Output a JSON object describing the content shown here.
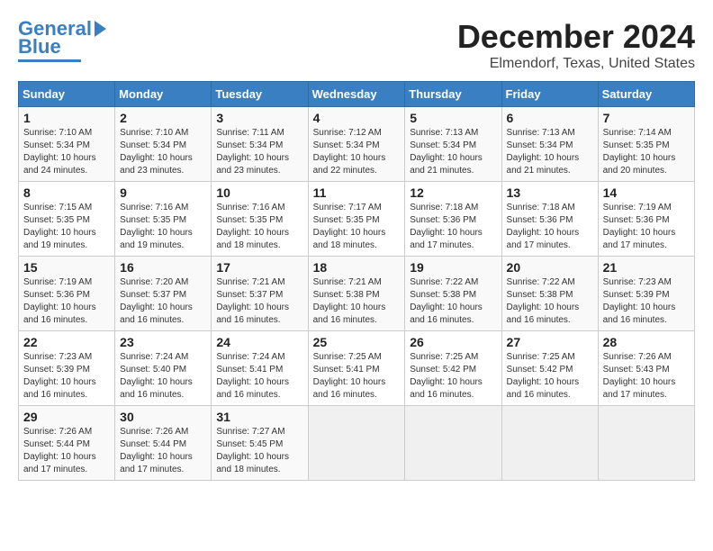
{
  "header": {
    "logo_line1": "General",
    "logo_line2": "Blue",
    "title": "December 2024",
    "subtitle": "Elmendorf, Texas, United States"
  },
  "days_of_week": [
    "Sunday",
    "Monday",
    "Tuesday",
    "Wednesday",
    "Thursday",
    "Friday",
    "Saturday"
  ],
  "weeks": [
    [
      {
        "day": "1",
        "lines": [
          "Sunrise: 7:10 AM",
          "Sunset: 5:34 PM",
          "Daylight: 10 hours",
          "and 24 minutes."
        ]
      },
      {
        "day": "2",
        "lines": [
          "Sunrise: 7:10 AM",
          "Sunset: 5:34 PM",
          "Daylight: 10 hours",
          "and 23 minutes."
        ]
      },
      {
        "day": "3",
        "lines": [
          "Sunrise: 7:11 AM",
          "Sunset: 5:34 PM",
          "Daylight: 10 hours",
          "and 23 minutes."
        ]
      },
      {
        "day": "4",
        "lines": [
          "Sunrise: 7:12 AM",
          "Sunset: 5:34 PM",
          "Daylight: 10 hours",
          "and 22 minutes."
        ]
      },
      {
        "day": "5",
        "lines": [
          "Sunrise: 7:13 AM",
          "Sunset: 5:34 PM",
          "Daylight: 10 hours",
          "and 21 minutes."
        ]
      },
      {
        "day": "6",
        "lines": [
          "Sunrise: 7:13 AM",
          "Sunset: 5:34 PM",
          "Daylight: 10 hours",
          "and 21 minutes."
        ]
      },
      {
        "day": "7",
        "lines": [
          "Sunrise: 7:14 AM",
          "Sunset: 5:35 PM",
          "Daylight: 10 hours",
          "and 20 minutes."
        ]
      }
    ],
    [
      {
        "day": "8",
        "lines": [
          "Sunrise: 7:15 AM",
          "Sunset: 5:35 PM",
          "Daylight: 10 hours",
          "and 19 minutes."
        ]
      },
      {
        "day": "9",
        "lines": [
          "Sunrise: 7:16 AM",
          "Sunset: 5:35 PM",
          "Daylight: 10 hours",
          "and 19 minutes."
        ]
      },
      {
        "day": "10",
        "lines": [
          "Sunrise: 7:16 AM",
          "Sunset: 5:35 PM",
          "Daylight: 10 hours",
          "and 18 minutes."
        ]
      },
      {
        "day": "11",
        "lines": [
          "Sunrise: 7:17 AM",
          "Sunset: 5:35 PM",
          "Daylight: 10 hours",
          "and 18 minutes."
        ]
      },
      {
        "day": "12",
        "lines": [
          "Sunrise: 7:18 AM",
          "Sunset: 5:36 PM",
          "Daylight: 10 hours",
          "and 17 minutes."
        ]
      },
      {
        "day": "13",
        "lines": [
          "Sunrise: 7:18 AM",
          "Sunset: 5:36 PM",
          "Daylight: 10 hours",
          "and 17 minutes."
        ]
      },
      {
        "day": "14",
        "lines": [
          "Sunrise: 7:19 AM",
          "Sunset: 5:36 PM",
          "Daylight: 10 hours",
          "and 17 minutes."
        ]
      }
    ],
    [
      {
        "day": "15",
        "lines": [
          "Sunrise: 7:19 AM",
          "Sunset: 5:36 PM",
          "Daylight: 10 hours",
          "and 16 minutes."
        ]
      },
      {
        "day": "16",
        "lines": [
          "Sunrise: 7:20 AM",
          "Sunset: 5:37 PM",
          "Daylight: 10 hours",
          "and 16 minutes."
        ]
      },
      {
        "day": "17",
        "lines": [
          "Sunrise: 7:21 AM",
          "Sunset: 5:37 PM",
          "Daylight: 10 hours",
          "and 16 minutes."
        ]
      },
      {
        "day": "18",
        "lines": [
          "Sunrise: 7:21 AM",
          "Sunset: 5:38 PM",
          "Daylight: 10 hours",
          "and 16 minutes."
        ]
      },
      {
        "day": "19",
        "lines": [
          "Sunrise: 7:22 AM",
          "Sunset: 5:38 PM",
          "Daylight: 10 hours",
          "and 16 minutes."
        ]
      },
      {
        "day": "20",
        "lines": [
          "Sunrise: 7:22 AM",
          "Sunset: 5:38 PM",
          "Daylight: 10 hours",
          "and 16 minutes."
        ]
      },
      {
        "day": "21",
        "lines": [
          "Sunrise: 7:23 AM",
          "Sunset: 5:39 PM",
          "Daylight: 10 hours",
          "and 16 minutes."
        ]
      }
    ],
    [
      {
        "day": "22",
        "lines": [
          "Sunrise: 7:23 AM",
          "Sunset: 5:39 PM",
          "Daylight: 10 hours",
          "and 16 minutes."
        ]
      },
      {
        "day": "23",
        "lines": [
          "Sunrise: 7:24 AM",
          "Sunset: 5:40 PM",
          "Daylight: 10 hours",
          "and 16 minutes."
        ]
      },
      {
        "day": "24",
        "lines": [
          "Sunrise: 7:24 AM",
          "Sunset: 5:41 PM",
          "Daylight: 10 hours",
          "and 16 minutes."
        ]
      },
      {
        "day": "25",
        "lines": [
          "Sunrise: 7:25 AM",
          "Sunset: 5:41 PM",
          "Daylight: 10 hours",
          "and 16 minutes."
        ]
      },
      {
        "day": "26",
        "lines": [
          "Sunrise: 7:25 AM",
          "Sunset: 5:42 PM",
          "Daylight: 10 hours",
          "and 16 minutes."
        ]
      },
      {
        "day": "27",
        "lines": [
          "Sunrise: 7:25 AM",
          "Sunset: 5:42 PM",
          "Daylight: 10 hours",
          "and 16 minutes."
        ]
      },
      {
        "day": "28",
        "lines": [
          "Sunrise: 7:26 AM",
          "Sunset: 5:43 PM",
          "Daylight: 10 hours",
          "and 17 minutes."
        ]
      }
    ],
    [
      {
        "day": "29",
        "lines": [
          "Sunrise: 7:26 AM",
          "Sunset: 5:44 PM",
          "Daylight: 10 hours",
          "and 17 minutes."
        ]
      },
      {
        "day": "30",
        "lines": [
          "Sunrise: 7:26 AM",
          "Sunset: 5:44 PM",
          "Daylight: 10 hours",
          "and 17 minutes."
        ]
      },
      {
        "day": "31",
        "lines": [
          "Sunrise: 7:27 AM",
          "Sunset: 5:45 PM",
          "Daylight: 10 hours",
          "and 18 minutes."
        ]
      },
      null,
      null,
      null,
      null
    ]
  ]
}
